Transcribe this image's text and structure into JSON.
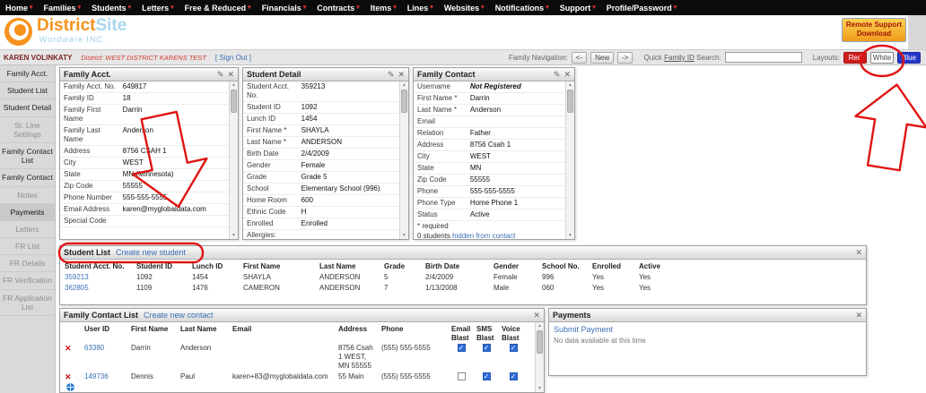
{
  "nav": {
    "items": [
      "Home",
      "Families",
      "Students",
      "Letters",
      "Free & Reduced",
      "Financials",
      "Contracts",
      "Items",
      "Lines",
      "Websites",
      "Notifications",
      "Support",
      "Profile/Password"
    ]
  },
  "header": {
    "brand_primary": "District",
    "brand_secondary": "Site",
    "brand_tagline": "Wordware INC.",
    "remote_button_line1": "Remote Support",
    "remote_button_line2": "Download"
  },
  "toolbar": {
    "user_name": "KAREN VOLINKATY",
    "district_label": "District: WEST DISTRICT KARENS TEST",
    "sign_out": "[ Sign Out ]",
    "family_nav_label": "Family Navigation:",
    "prev_button": "<-",
    "new_button": "New",
    "next_button": "->",
    "quick_search_prefix": "Quick",
    "quick_search_link": "Family ID",
    "quick_search_suffix": "Search:",
    "search_value": "",
    "layouts_label": "Layouts:",
    "layout_red": "Red",
    "layout_white": "White",
    "layout_blue": "Blue"
  },
  "sidebar": {
    "items": [
      {
        "label": "Family Acct.",
        "active": true,
        "selected": false
      },
      {
        "label": "Student List",
        "active": true,
        "selected": false
      },
      {
        "label": "Student Detail",
        "active": true,
        "selected": false
      },
      {
        "label": "St. Line Settings",
        "active": false,
        "selected": false
      },
      {
        "label": "Family Contact List",
        "active": true,
        "selected": false
      },
      {
        "label": "Family Contact",
        "active": true,
        "selected": false
      },
      {
        "label": "Notes",
        "active": false,
        "selected": false
      },
      {
        "label": "Payments",
        "active": true,
        "selected": true
      },
      {
        "label": "Letters",
        "active": false,
        "selected": false
      },
      {
        "label": "FR List",
        "active": false,
        "selected": false
      },
      {
        "label": "FR Details",
        "active": false,
        "selected": false
      },
      {
        "label": "FR Verification",
        "active": false,
        "selected": false
      },
      {
        "label": "FR Application List",
        "active": false,
        "selected": false
      }
    ]
  },
  "panels": {
    "family_acct": {
      "title": "Family Acct.",
      "fields": [
        {
          "label": "Family Acct. No.",
          "value": "649817"
        },
        {
          "label": "Family ID",
          "value": "18"
        },
        {
          "label": "Family First Name",
          "value": "Darrin"
        },
        {
          "label": "Family Last Name",
          "value": "Anderson"
        },
        {
          "label": "Address",
          "value": "8756 CSAH 1"
        },
        {
          "label": "City",
          "value": "WEST"
        },
        {
          "label": "State",
          "value": "MN (Minnesota)"
        },
        {
          "label": "Zip Code",
          "value": "55555"
        },
        {
          "label": "Phone Number",
          "value": "555-555-5555"
        },
        {
          "label": "Email Address",
          "value": "karen@myglobaldata.com"
        },
        {
          "label": "Special Code",
          "value": ""
        }
      ]
    },
    "student_detail": {
      "title": "Student Detail",
      "fields": [
        {
          "label": "Student Acct. No.",
          "value": "359213"
        },
        {
          "label": "Student ID",
          "value": "1092"
        },
        {
          "label": "Lunch ID",
          "value": "1454"
        },
        {
          "label": "First Name *",
          "value": "SHAYLA"
        },
        {
          "label": "Last Name *",
          "value": "ANDERSON"
        },
        {
          "label": "Birth Date",
          "value": "2/4/2009"
        },
        {
          "label": "Gender",
          "value": "Female"
        },
        {
          "label": "Grade",
          "value": "Grade 5"
        },
        {
          "label": "School",
          "value": "Elementary School (996)"
        },
        {
          "label": "Home Room",
          "value": "600"
        },
        {
          "label": "Ethnic Code",
          "value": "H"
        },
        {
          "label": "Enrolled",
          "value": "Enrolled"
        },
        {
          "label": "Allergies:",
          "value": ""
        }
      ]
    },
    "family_contact": {
      "title": "Family Contact",
      "fields": [
        {
          "label": "Username",
          "value": "Not Registered",
          "em": true
        },
        {
          "label": "First Name *",
          "value": "Darrin"
        },
        {
          "label": "Last Name *",
          "value": "Anderson"
        },
        {
          "label": "Email",
          "value": ""
        },
        {
          "label": "Relation",
          "value": "Father"
        },
        {
          "label": "Address",
          "value": "8756 Csah 1"
        },
        {
          "label": "City",
          "value": "WEST"
        },
        {
          "label": "State",
          "value": "MN"
        },
        {
          "label": "Zip Code",
          "value": "55555"
        },
        {
          "label": "Phone",
          "value": "555-555-5555"
        },
        {
          "label": "Phone Type",
          "value": "Home Phone 1"
        },
        {
          "label": "Status",
          "value": "Active"
        }
      ],
      "required_note": "* required",
      "hidden_prefix": "0 students",
      "hidden_link": "hidden from contact"
    },
    "student_list": {
      "title": "Student List",
      "create_link": "Create new student",
      "columns": [
        "Student Acct. No.",
        "Student ID",
        "Lunch ID",
        "First Name",
        "Last Name",
        "Grade",
        "Birth Date",
        "Gender",
        "School No.",
        "Enrolled",
        "Active"
      ],
      "rows": [
        [
          "359213",
          "1092",
          "1454",
          "SHAYLA",
          "ANDERSON",
          "5",
          "2/4/2009",
          "Female",
          "996",
          "Yes",
          "Yes"
        ],
        [
          "362805",
          "1109",
          "1476",
          "CAMERON",
          "ANDERSON",
          "7",
          "1/13/2008",
          "Male",
          "060",
          "Yes",
          "Yes"
        ]
      ]
    },
    "family_contact_list": {
      "title": "Family Contact List",
      "create_link": "Create new contact",
      "columns": [
        "",
        "User ID",
        "First Name",
        "Last Name",
        "Email",
        "Address",
        "Phone",
        "Email Blast",
        "SMS Blast",
        "Voice Blast"
      ],
      "rows": [
        {
          "user_id": "63380",
          "first_name": "Darrin",
          "last_name": "Anderson",
          "email": "",
          "address": "8756 Csah 1 WEST, MN 55555",
          "phone": "(555) 555-5555",
          "email_blast": true,
          "sms_blast": true,
          "voice_blast": true,
          "has_globe": false
        },
        {
          "user_id": "149736",
          "first_name": "Dennis",
          "last_name": "Paul",
          "email": "karen+83@myglobaldata.com",
          "address": "55 Main",
          "phone": "(555) 555-5555",
          "email_blast": false,
          "sms_blast": true,
          "voice_blast": true,
          "has_globe": true
        }
      ]
    },
    "payments": {
      "title": "Payments",
      "submit_link": "Submit Payment",
      "empty_message": "No data available at this time"
    }
  },
  "colors": {
    "accent_orange": "#f6921e",
    "accent_light_blue": "#a9d7ec",
    "link_blue": "#3b6fb5",
    "annotation_red": "#e01414",
    "layout_red": "#cf1d1d",
    "layout_blue": "#2438c9"
  }
}
